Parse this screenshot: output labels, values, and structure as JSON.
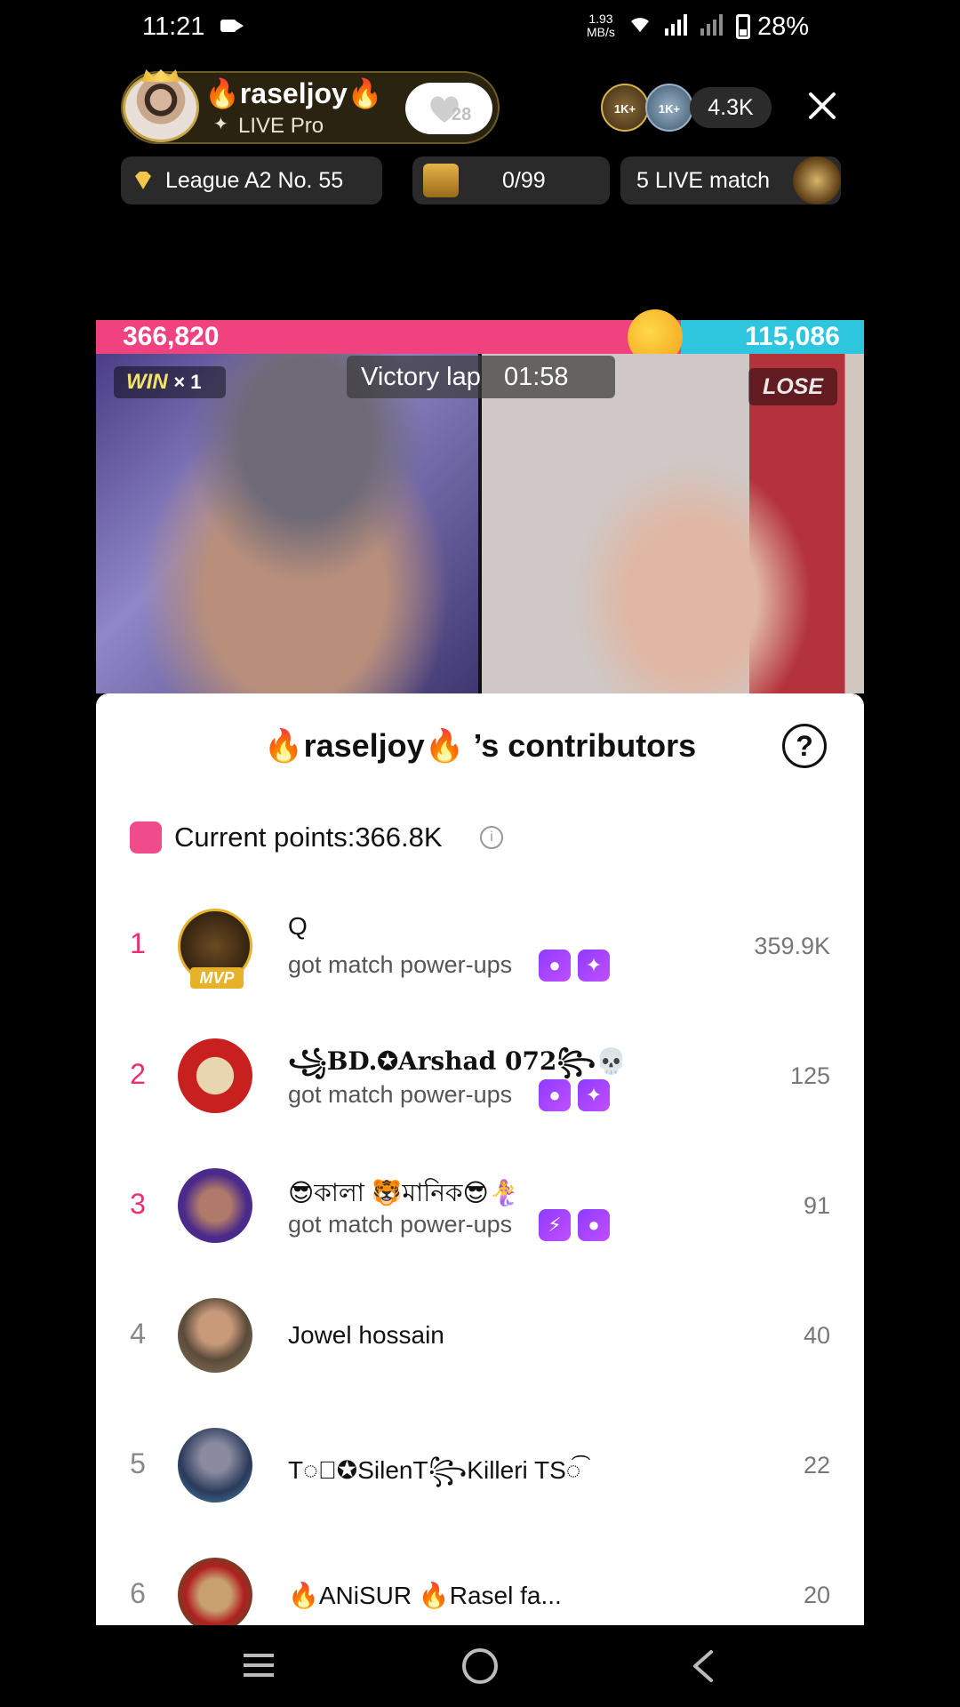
{
  "status_bar": {
    "time": "11:21",
    "net_speed_value": "1.93",
    "net_speed_unit": "MB/s",
    "battery": "28%"
  },
  "header": {
    "host_name": "🔥raseljoy🔥",
    "host_subtitle": "LIVE Pro",
    "follow_count": "28",
    "viewer_badges": [
      "1K+",
      "1K+"
    ],
    "viewer_count": "4.3K"
  },
  "chips": {
    "league": "League A2 No. 55",
    "treasure": "0/99",
    "live_match": "5 LIVE match"
  },
  "battle": {
    "left_score": "366,820",
    "right_score": "115,086",
    "win_label": "WIN",
    "win_multiplier": "× 1",
    "victory_label": "Victory lap",
    "timer": "01:58",
    "lose_label": "LOSE",
    "left_share": 0.761
  },
  "contributors": {
    "title": "🔥raseljoy🔥 ’s contributors",
    "points_label": "Current points:366.8K",
    "rows": [
      {
        "rank": "1",
        "name": "Q",
        "sub": "got match power-ups",
        "score": "359.9K",
        "badge": "MVP"
      },
      {
        "rank": "2",
        "name": "꧁BD.✪Arshad 072꧂💀",
        "sub": "got match power-ups",
        "score": "125"
      },
      {
        "rank": "3",
        "name": "😎কালা 🐯মানিক😎🧜‍♀️",
        "sub": "got match power-ups",
        "score": "91"
      },
      {
        "rank": "4",
        "name": "Jowel hossain",
        "score": "40"
      },
      {
        "rank": "5",
        "name": "T◌⃝✪SilenT꧂Killeri  TS◌͡",
        "score": "22"
      },
      {
        "rank": "6",
        "name": "🔥ANiSUR 🔥Rasel fa...",
        "score": "20"
      }
    ]
  },
  "colors": {
    "accent_pink": "#f02e6f",
    "score_blue": "#2ec6de",
    "power_up_purple": "#9b3bff"
  }
}
